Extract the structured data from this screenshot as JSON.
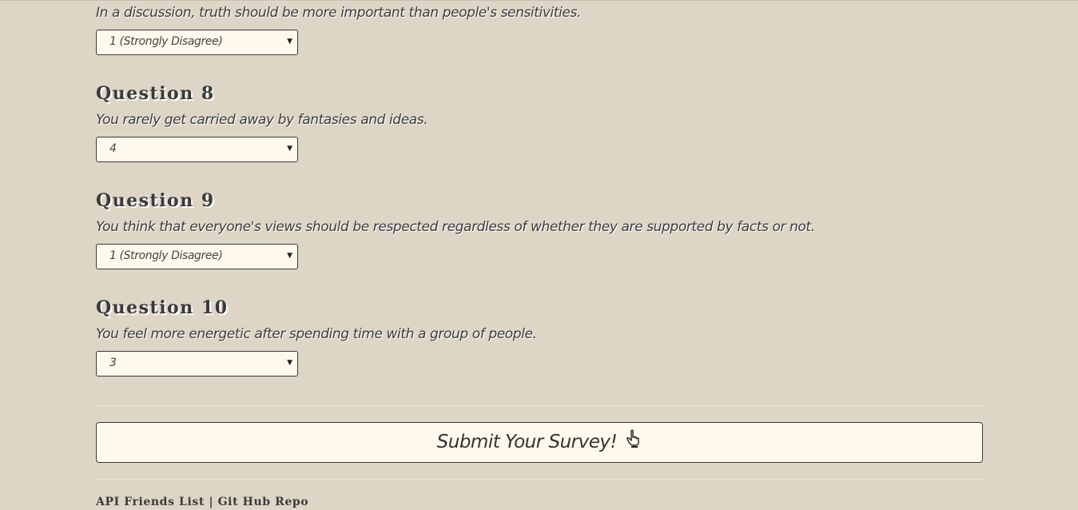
{
  "questions": [
    {
      "heading": "",
      "text": "In a discussion, truth should be more important than people's sensitivities.",
      "selected": "1 (Strongly Disagree)"
    },
    {
      "heading": "Question 8",
      "text": "You rarely get carried away by fantasies and ideas.",
      "selected": "4"
    },
    {
      "heading": "Question 9",
      "text": "You think that everyone's views should be respected regardless of whether they are supported by facts or not.",
      "selected": "1 (Strongly Disagree)"
    },
    {
      "heading": "Question 10",
      "text": "You feel more energetic after spending time with a group of people.",
      "selected": "3"
    }
  ],
  "submit": {
    "label": "Submit Your Survey!",
    "icon": "pointing-hand-icon"
  },
  "footer": {
    "api_link": "API Friends List",
    "separator": "|",
    "repo_link": "Git Hub Repo"
  },
  "colors": {
    "background": "#ddd5c6",
    "control_background": "#fff8ec",
    "text": "#3a3a3a"
  }
}
